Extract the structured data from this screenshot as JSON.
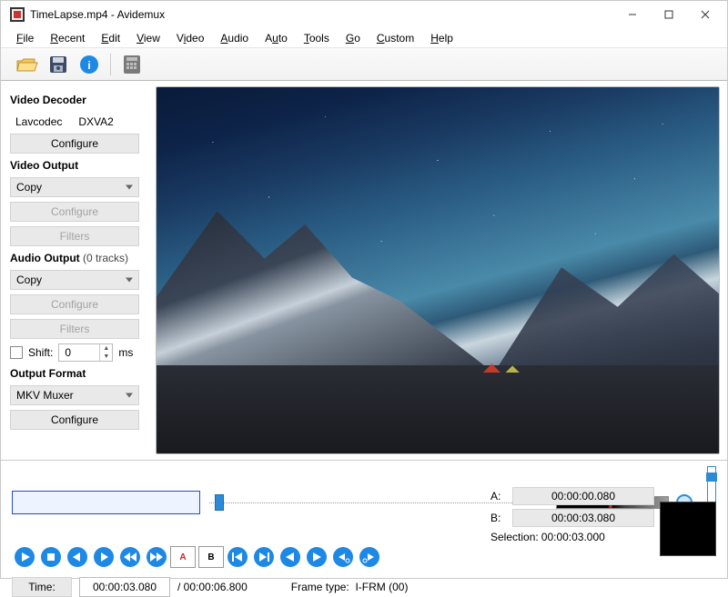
{
  "window": {
    "title": "TimeLapse.mp4 - Avidemux"
  },
  "menu": {
    "file": "File",
    "recent": "Recent",
    "edit": "Edit",
    "view": "View",
    "video": "Video",
    "audio": "Audio",
    "auto": "Auto",
    "tools": "Tools",
    "go": "Go",
    "custom": "Custom",
    "help": "Help"
  },
  "sidebar": {
    "video_decoder": {
      "title": "Video Decoder",
      "codec1": "Lavcodec",
      "codec2": "DXVA2",
      "configure": "Configure"
    },
    "video_output": {
      "title": "Video Output",
      "value": "Copy",
      "configure": "Configure",
      "filters": "Filters"
    },
    "audio_output": {
      "title": "Audio Output",
      "tracks": "(0 tracks)",
      "value": "Copy",
      "configure": "Configure",
      "filters": "Filters",
      "shift_label": "Shift:",
      "shift_value": "0",
      "shift_unit": "ms"
    },
    "output_format": {
      "title": "Output Format",
      "value": "MKV Muxer",
      "configure": "Configure"
    }
  },
  "markers": {
    "a_label": "A:",
    "a_value": "00:00:00.080",
    "b_label": "B:",
    "b_value": "00:00:03.080",
    "selection_label": "Selection:",
    "selection_value": "00:00:03.000"
  },
  "status": {
    "time_label": "Time:",
    "time_value": "00:00:03.080",
    "total_prefix": "/ ",
    "total_value": "00:00:06.800",
    "frame_type_label": "Frame type:",
    "frame_type_value": "I-FRM (00)"
  }
}
